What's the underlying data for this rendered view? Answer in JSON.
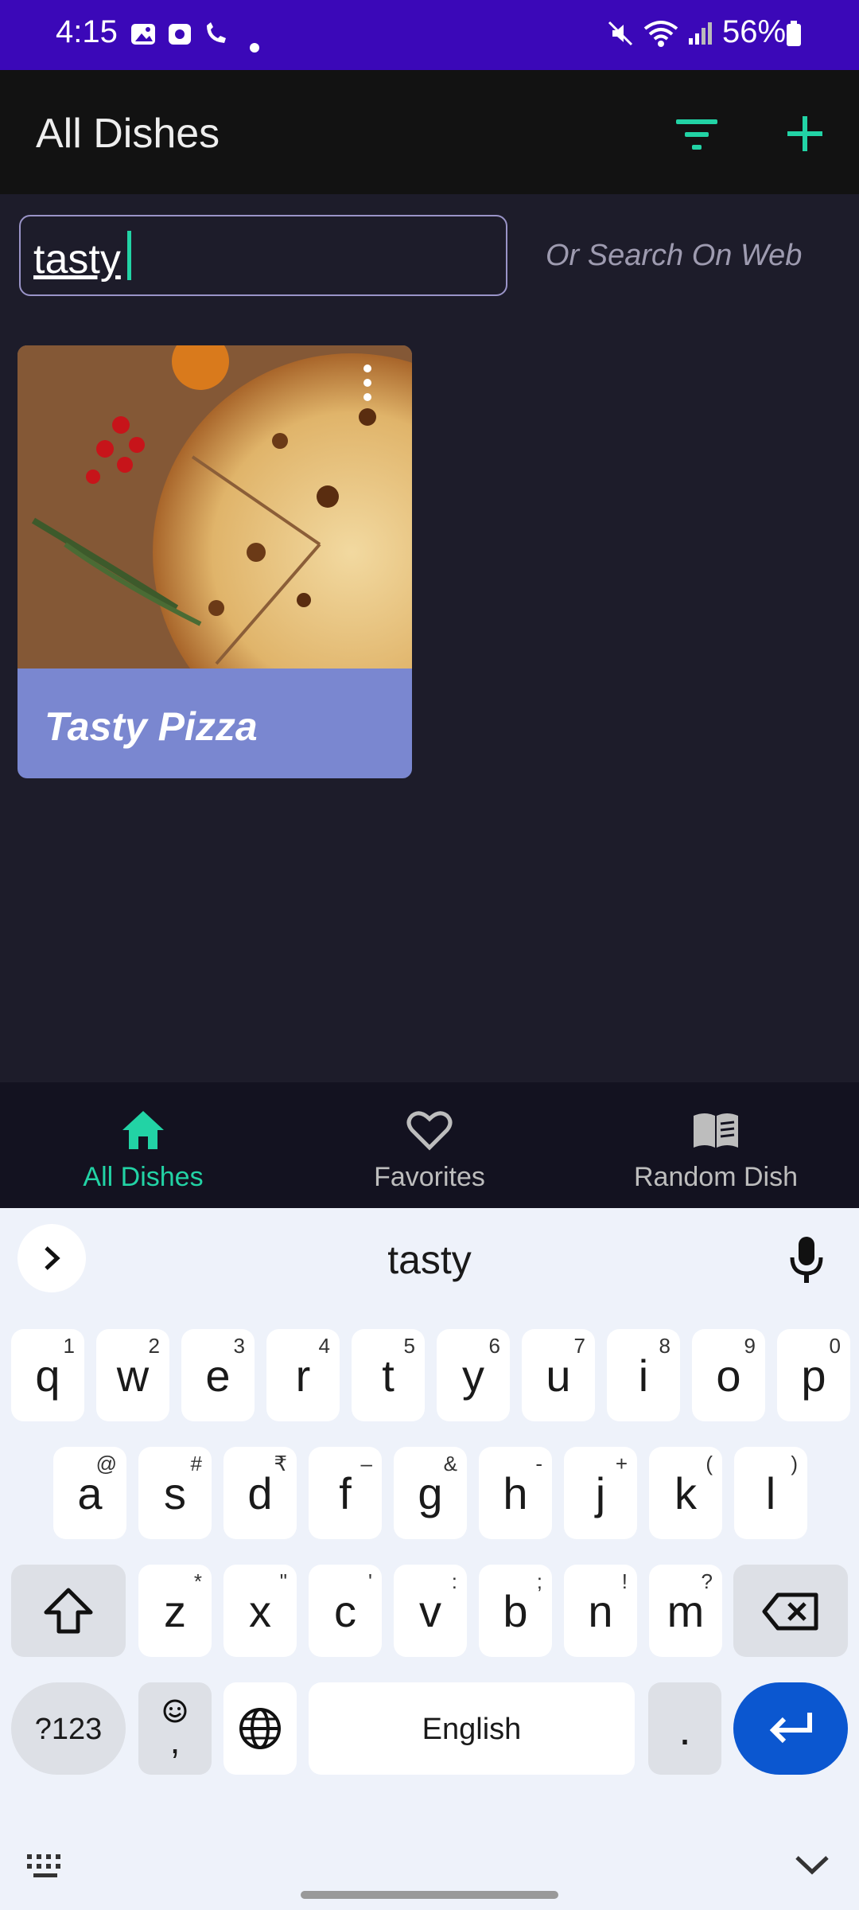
{
  "status_bar": {
    "time": "4:15",
    "battery": "56%"
  },
  "app_bar": {
    "title": "All Dishes"
  },
  "search": {
    "value": "tasty",
    "web_label": "Or Search On Web"
  },
  "dishes": [
    {
      "title": "Tasty Pizza"
    }
  ],
  "bottom_nav": [
    {
      "label": "All Dishes",
      "active": true
    },
    {
      "label": "Favorites",
      "active": false
    },
    {
      "label": "Random Dish",
      "active": false
    }
  ],
  "keyboard": {
    "suggestion": "tasty",
    "row1": [
      {
        "ch": "q",
        "hint": "1"
      },
      {
        "ch": "w",
        "hint": "2"
      },
      {
        "ch": "e",
        "hint": "3"
      },
      {
        "ch": "r",
        "hint": "4"
      },
      {
        "ch": "t",
        "hint": "5"
      },
      {
        "ch": "y",
        "hint": "6"
      },
      {
        "ch": "u",
        "hint": "7"
      },
      {
        "ch": "i",
        "hint": "8"
      },
      {
        "ch": "o",
        "hint": "9"
      },
      {
        "ch": "p",
        "hint": "0"
      }
    ],
    "row2": [
      {
        "ch": "a",
        "hint": "@"
      },
      {
        "ch": "s",
        "hint": "#"
      },
      {
        "ch": "d",
        "hint": "₹"
      },
      {
        "ch": "f",
        "hint": "–"
      },
      {
        "ch": "g",
        "hint": "&"
      },
      {
        "ch": "h",
        "hint": "-"
      },
      {
        "ch": "j",
        "hint": "+"
      },
      {
        "ch": "k",
        "hint": "("
      },
      {
        "ch": "l",
        "hint": ")"
      }
    ],
    "row3": [
      {
        "ch": "z",
        "hint": "*"
      },
      {
        "ch": "x",
        "hint": "\""
      },
      {
        "ch": "c",
        "hint": "'"
      },
      {
        "ch": "v",
        "hint": ":"
      },
      {
        "ch": "b",
        "hint": ";"
      },
      {
        "ch": "n",
        "hint": "!"
      },
      {
        "ch": "m",
        "hint": "?"
      }
    ],
    "symbols_label": "?123",
    "comma_label": ",",
    "space_label": "English",
    "period_label": "."
  },
  "colors": {
    "status_bar": "#3b08b8",
    "accent": "#22d3a5",
    "card": "#7a87d0",
    "enter": "#0b57d0"
  }
}
